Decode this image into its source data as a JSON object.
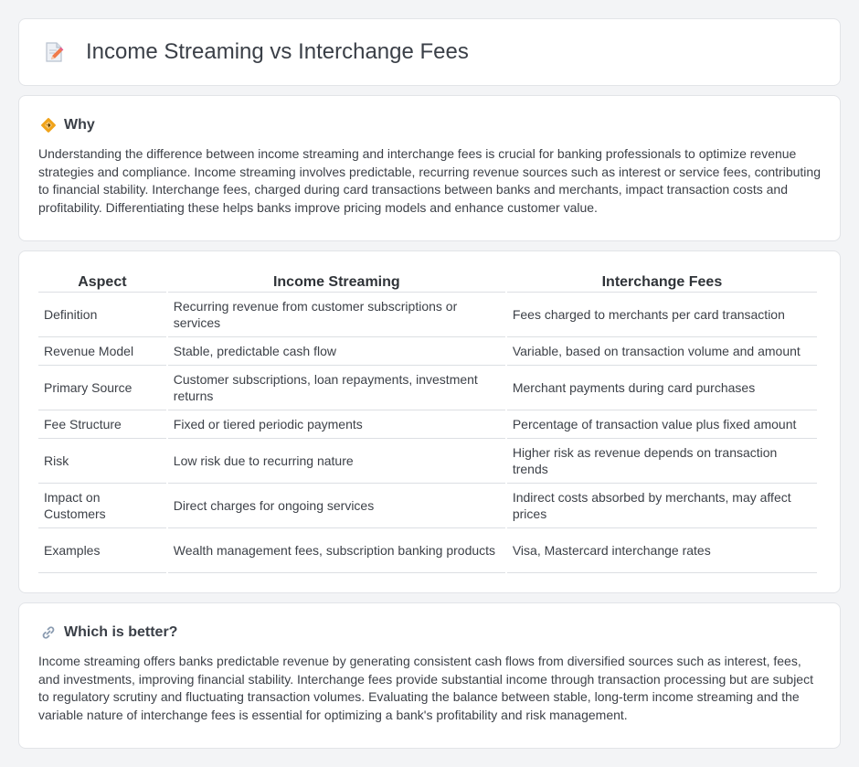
{
  "header": {
    "title": "Income Streaming vs Interchange Fees",
    "icon": "document-pencil-icon"
  },
  "why": {
    "icon": "diamond-sign-icon",
    "title": "Why",
    "body": "Understanding the difference between income streaming and interchange fees is crucial for banking professionals to optimize revenue strategies and compliance. Income streaming involves predictable, recurring revenue sources such as interest or service fees, contributing to financial stability. Interchange fees, charged during card transactions between banks and merchants, impact transaction costs and profitability. Differentiating these helps banks improve pricing models and enhance customer value."
  },
  "table": {
    "headers": [
      "Aspect",
      "Income Streaming",
      "Interchange Fees"
    ],
    "rows": [
      [
        "Definition",
        "Recurring revenue from customer subscriptions or services",
        "Fees charged to merchants per card transaction"
      ],
      [
        "Revenue Model",
        "Stable, predictable cash flow",
        "Variable, based on transaction volume and amount"
      ],
      [
        "Primary Source",
        "Customer subscriptions, loan repayments, investment returns",
        "Merchant payments during card purchases"
      ],
      [
        "Fee Structure",
        "Fixed or tiered periodic payments",
        "Percentage of transaction value plus fixed amount"
      ],
      [
        "Risk",
        "Low risk due to recurring nature",
        "Higher risk as revenue depends on transaction trends"
      ],
      [
        "Impact on Customers",
        "Direct charges for ongoing services",
        "Indirect costs absorbed by merchants, may affect prices"
      ],
      [
        "Examples",
        "Wealth management fees, subscription banking products",
        "Visa, Mastercard interchange rates"
      ]
    ]
  },
  "better": {
    "icon": "link-icon",
    "title": "Which is better?",
    "body": "Income streaming offers banks predictable revenue by generating consistent cash flows from diversified sources such as interest, fees, and investments, improving financial stability. Interchange fees provide substantial income through transaction processing but are subject to regulatory scrutiny and fluctuating transaction volumes. Evaluating the balance between stable, long-term income streaming and the variable nature of interchange fees is essential for optimizing a bank's profitability and risk management."
  },
  "colors": {
    "background": "#f3f4f6",
    "card": "#ffffff",
    "border": "#dcdfe3",
    "why_icon": "#f0a31a",
    "link_icon": "#8a9bb0"
  }
}
